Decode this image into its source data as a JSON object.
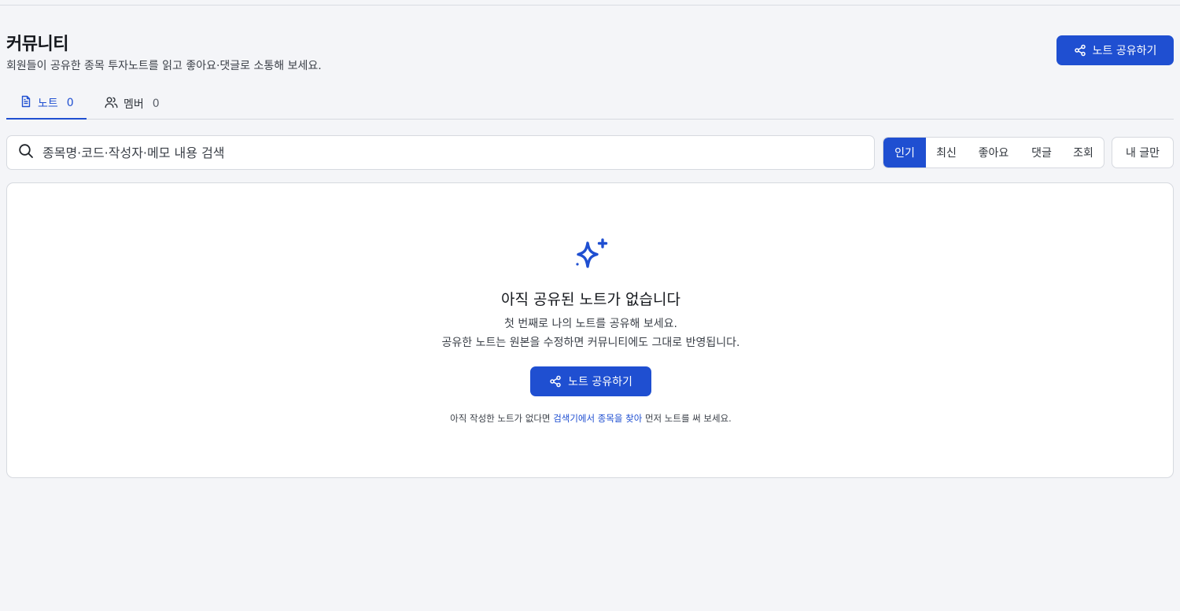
{
  "header": {
    "title": "커뮤니티",
    "subtitle": "회원들이 공유한 종목 투자노트를 읽고 좋아요·댓글로 소통해 보세요.",
    "share_button_label": "노트 공유하기"
  },
  "tabs": [
    {
      "label": "노트",
      "count": "0",
      "icon": "document-icon",
      "active": true
    },
    {
      "label": "멤버",
      "count": "0",
      "icon": "users-icon",
      "active": false
    }
  ],
  "search": {
    "placeholder": "종목명·코드·작성자·메모 내용 검색",
    "value": ""
  },
  "sort_options": [
    {
      "label": "인기",
      "active": true
    },
    {
      "label": "최신",
      "active": false
    },
    {
      "label": "좋아요",
      "active": false
    },
    {
      "label": "댓글",
      "active": false
    },
    {
      "label": "조회",
      "active": false
    }
  ],
  "mine_filter_label": "내 글만",
  "empty_state": {
    "icon": "sparkle-icon",
    "title": "아직 공유된 노트가 없습니다",
    "desc_line1": "첫 번째로 나의 노트를 공유해 보세요.",
    "desc_line2": "공유한 노트는 원본을 수정하면 커뮤니티에도 그대로 반영됩니다.",
    "share_button_label": "노트 공유하기",
    "hint_prefix": "아직 작성한 노트가 없다면 ",
    "hint_link": "검색기에서 종목을 찾아",
    "hint_suffix": " 먼저 노트를 써 보세요."
  },
  "colors": {
    "accent": "#1f4fd1",
    "background": "#f4f5f8",
    "card": "#ffffff",
    "border": "#d6d9df"
  }
}
